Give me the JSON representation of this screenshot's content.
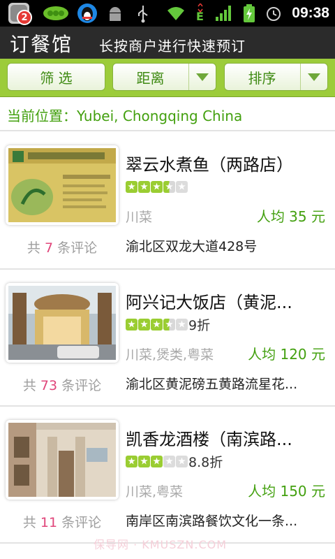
{
  "status_bar": {
    "notification_count": "2",
    "time": "09:38",
    "icons": [
      "app-notification-icon",
      "pea-app-icon",
      "qq-icon",
      "android-debug-icon",
      "usb-icon",
      "wifi-icon",
      "edge-signal-icon",
      "signal-bars-icon",
      "battery-charging-icon",
      "alarm-icon"
    ]
  },
  "header": {
    "title": "订餐馆",
    "subtitle": "长按商户进行快速预订"
  },
  "filters": {
    "filter_label": "筛 选",
    "distance_label": "距离",
    "sort_label": "排序"
  },
  "location": "当前位置：Yubei, Chongqing China",
  "restaurants": [
    {
      "name": "翠云水煮鱼（两路店）",
      "rating": 3.5,
      "discount": "",
      "cuisine": "川菜",
      "price": "人均 35 元",
      "address": "渝北区双龙大道428号",
      "reviews_prefix": "共",
      "review_count": "7",
      "reviews_suffix": "条评论"
    },
    {
      "name": "阿兴记大饭店（黄泥...",
      "rating": 3.5,
      "discount": "9折",
      "cuisine": "川菜,煲类,粤菜",
      "price": "人均 120 元",
      "address": "渝北区黄泥磅五黄路流星花...",
      "reviews_prefix": "共",
      "review_count": "73",
      "reviews_suffix": "条评论"
    },
    {
      "name": "凯香龙酒楼（南滨路...",
      "rating": 3,
      "discount": "8.8折",
      "cuisine": "川菜,粤菜",
      "price": "人均 150 元",
      "address": "南岸区南滨路餐饮文化一条...",
      "reviews_prefix": "共",
      "review_count": "11",
      "reviews_suffix": "条评论"
    }
  ],
  "watermark": "保导网 · KMUSZN.COM",
  "colors": {
    "accent_green": "#43a00f",
    "filter_bar": "#9ccc3a",
    "review_count": "#e0457a"
  }
}
